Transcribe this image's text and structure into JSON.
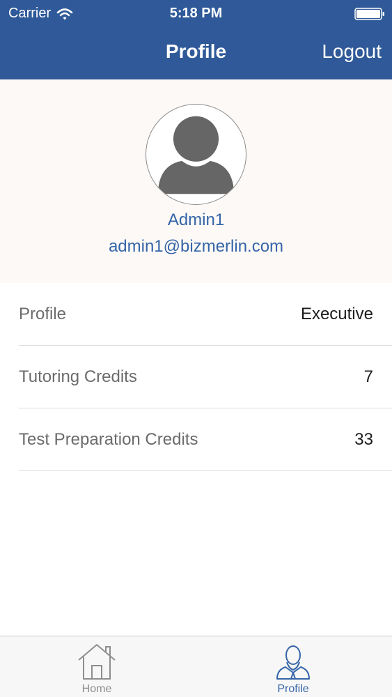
{
  "status_bar": {
    "carrier": "Carrier",
    "time": "5:18 PM"
  },
  "nav": {
    "title": "Profile",
    "logout_label": "Logout"
  },
  "user": {
    "name": "Admin1",
    "email": "admin1@bizmerlin.com"
  },
  "info_rows": [
    {
      "label": "Profile",
      "value": "Executive"
    },
    {
      "label": "Tutoring Credits",
      "value": "7"
    },
    {
      "label": "Test Preparation Credits",
      "value": "33"
    }
  ],
  "tabs": [
    {
      "label": "Home",
      "icon": "house-icon",
      "selected": false
    },
    {
      "label": "Profile",
      "icon": "person-icon",
      "selected": true
    }
  ],
  "colors": {
    "header_bg": "#2f5998",
    "accent": "#3565a7",
    "tab_inactive": "#8e8e8e"
  }
}
